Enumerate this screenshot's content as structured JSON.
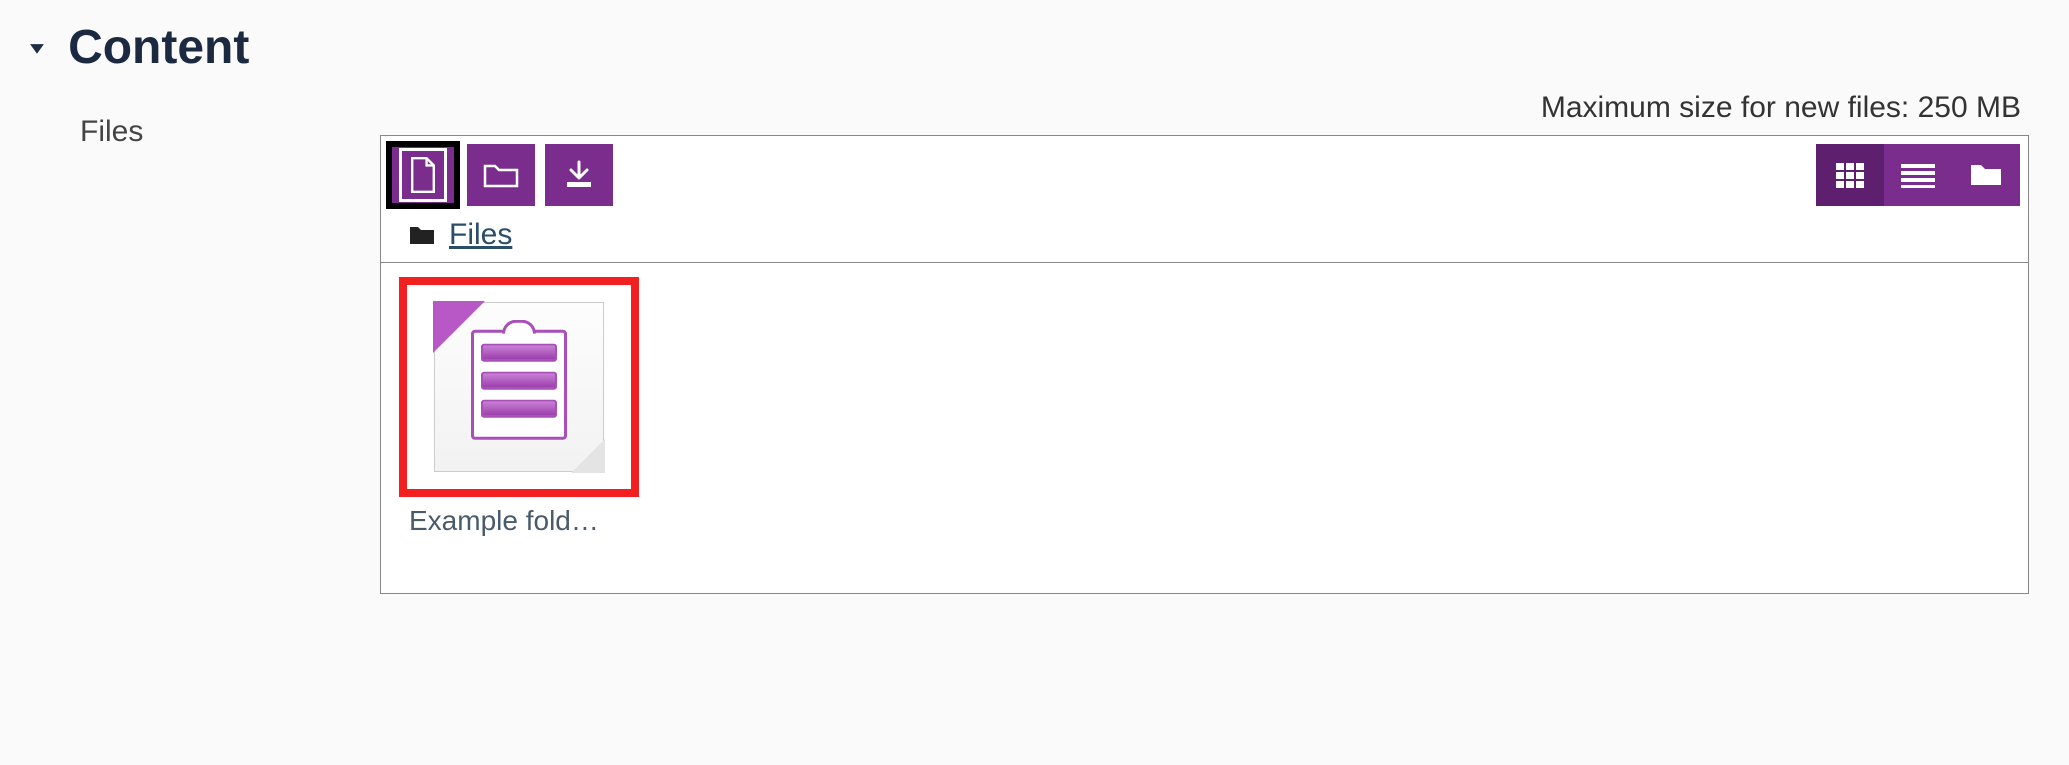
{
  "header": {
    "title": "Content"
  },
  "labels": {
    "files": "Files"
  },
  "maxsize_text": "Maximum size for new files: 250 MB",
  "breadcrumb": {
    "root": "Files"
  },
  "toolbar": {
    "add_file": "Add file",
    "create_folder": "Create folder",
    "download_all": "Download all"
  },
  "views": {
    "icons": "Icon view",
    "details": "Detail view",
    "tree": "Tree view"
  },
  "files": [
    {
      "name": "Example fold…"
    }
  ],
  "colors": {
    "accent": "#7b2d8e",
    "highlight": "#f22020"
  }
}
